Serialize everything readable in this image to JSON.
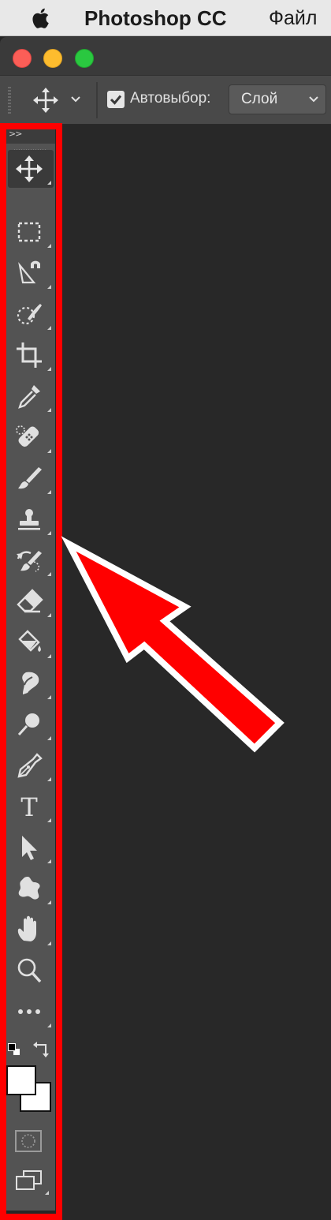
{
  "menubar": {
    "app_name": "Photoshop CC",
    "menu_file": "Файл"
  },
  "window": {
    "traffic_lights": [
      "close",
      "minimize",
      "maximize"
    ]
  },
  "options_bar": {
    "tool_icon": "move-icon",
    "auto_select_label": "Автовыбор:",
    "auto_select_checked": true,
    "auto_select_target": "Слой"
  },
  "toolbar": {
    "collapse_label": ">>",
    "tools": [
      {
        "name": "move-tool",
        "icon": "move-icon",
        "active": true
      },
      {
        "name": "rectangular-marquee-tool",
        "icon": "marquee-icon"
      },
      {
        "name": "magnetic-lasso-tool",
        "icon": "lasso-icon"
      },
      {
        "name": "quick-selection-tool",
        "icon": "quick-selection-icon"
      },
      {
        "name": "crop-tool",
        "icon": "crop-icon"
      },
      {
        "name": "eyedropper-tool",
        "icon": "eyedropper-icon"
      },
      {
        "name": "spot-healing-brush-tool",
        "icon": "bandage-icon"
      },
      {
        "name": "brush-tool",
        "icon": "brush-icon"
      },
      {
        "name": "clone-stamp-tool",
        "icon": "stamp-icon"
      },
      {
        "name": "history-brush-tool",
        "icon": "history-brush-icon"
      },
      {
        "name": "eraser-tool",
        "icon": "eraser-icon"
      },
      {
        "name": "paint-bucket-tool",
        "icon": "paint-bucket-icon"
      },
      {
        "name": "smudge-tool",
        "icon": "smudge-icon"
      },
      {
        "name": "dodge-tool",
        "icon": "dodge-icon"
      },
      {
        "name": "pen-tool",
        "icon": "pen-icon"
      },
      {
        "name": "horizontal-type-tool",
        "icon": "type-icon"
      },
      {
        "name": "path-selection-tool",
        "icon": "arrow-pointer-icon"
      },
      {
        "name": "custom-shape-tool",
        "icon": "custom-shape-icon"
      },
      {
        "name": "hand-tool",
        "icon": "hand-icon"
      },
      {
        "name": "zoom-tool",
        "icon": "magnifier-icon"
      },
      {
        "name": "edit-toolbar",
        "icon": "more-dots-icon"
      }
    ],
    "type_glyph": "T",
    "foreground_color": "#ffffff",
    "background_color": "#ffffff"
  },
  "annotation": {
    "highlight_color": "#ff0000"
  }
}
